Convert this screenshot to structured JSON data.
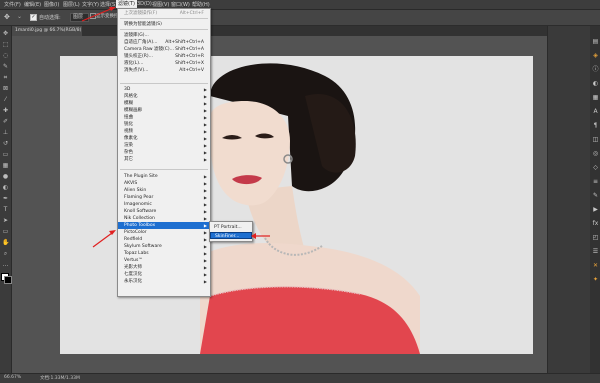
{
  "menubar": {
    "items": [
      "文件(F)",
      "编辑(E)",
      "图像(I)",
      "图层(L)",
      "文字(Y)",
      "选择(S)",
      "滤镜(T)",
      "3D(D)",
      "视图(V)",
      "窗口(W)",
      "帮助(H)"
    ]
  },
  "options": {
    "auto_select_label": "自动选择:",
    "auto_select_value": "图层",
    "transform_label": "显示变换控件"
  },
  "doc_tab": {
    "title": "1mardi0.jpg @ 66.7%(RGB/8)"
  },
  "status": {
    "zoom": "66.67%",
    "info": "文档:1.33M/1.33M"
  },
  "filter_menu": {
    "top_items": [
      {
        "label": "转换为智能滤镜(S)",
        "shortcut": ""
      },
      {
        "label": "滤镜库(G)...",
        "shortcut": ""
      },
      {
        "label": "自适应广角(A)...",
        "shortcut": "Alt+Shift+Ctrl+A"
      },
      {
        "label": "Camera Raw 滤镜(C)...",
        "shortcut": "Shift+Ctrl+A"
      },
      {
        "label": "镜头校正(R)...",
        "shortcut": "Shift+Ctrl+R"
      },
      {
        "label": "液化(L)...",
        "shortcut": "Shift+Ctrl+X"
      },
      {
        "label": "消失点(V)...",
        "shortcut": "Alt+Ctrl+V"
      }
    ],
    "builtin_items": [
      "3D",
      "风格化",
      "模糊",
      "模糊画廊",
      "扭曲",
      "锐化",
      "视频",
      "像素化",
      "渲染",
      "杂色",
      "其它"
    ],
    "plugin_items": [
      "The Plugin Site",
      "AKVIS",
      "Alien Skin",
      "Flaming Pear",
      "Imagenomic",
      "Knoll Software",
      "Nik Collection",
      "Photo Toolbox",
      "PictoColor",
      "Redfield",
      "Skylum Software",
      "Topaz Labs",
      "Vertus™",
      "光影大师",
      "七度汉化",
      "永乐汉化"
    ],
    "last_filter_shortcut": "Alt+Ctrl+F"
  },
  "submenu1": {
    "items": [
      "PT Portrait...",
      "SkinFiner..."
    ]
  },
  "colors": {
    "highlight": "#1e6fd0",
    "arrow": "#e02020",
    "accent_orange": "#e8a33a"
  }
}
